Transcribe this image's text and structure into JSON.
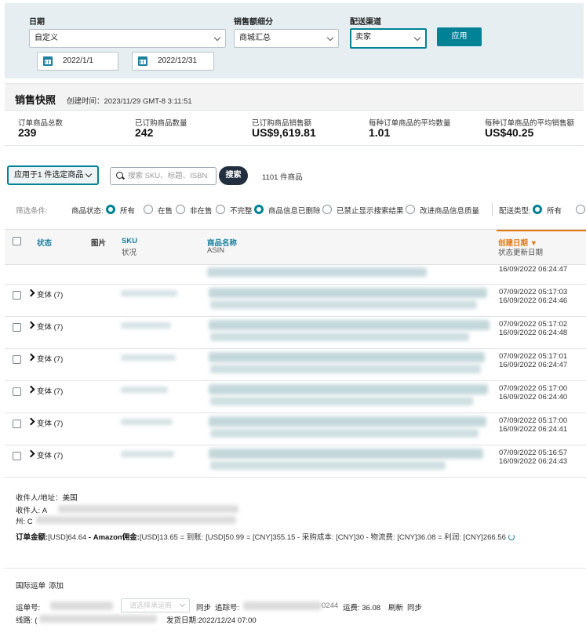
{
  "filters": {
    "date_label": "日期",
    "date_value": "自定义",
    "start_date": "2022/1/1",
    "end_date": "2022/12/31",
    "breakdown_label": "销售额细分",
    "breakdown_value": "商城汇总",
    "channel_label": "配送渠道",
    "channel_value": "卖家",
    "apply_label": "应用"
  },
  "snapshot": {
    "title": "销售快照",
    "created": "创建时间：2023/11/29 GMT-8 3:11:51",
    "metrics": [
      {
        "label": "订单商品总数",
        "value": "239"
      },
      {
        "label": "已订购商品数量",
        "value": "242"
      },
      {
        "label": "已订购商品销售额",
        "value": "US$9,619.81"
      },
      {
        "label": "每种订单商品的平均数量",
        "value": "1.01"
      },
      {
        "label": "每种订单商品的平均销售额",
        "value": "US$40.25"
      }
    ]
  },
  "toolbar": {
    "apply_to": "应用于1 件选定商品",
    "search_placeholder": "搜索 SKU、标题、ISBN",
    "search_button": "搜索",
    "count": "1101 件商品"
  },
  "conditions": {
    "label": "筛选条件:",
    "status_label": "商品状态:",
    "options": [
      "所有",
      "在售",
      "非在售",
      "不完整",
      "商品信息已删除",
      "已禁止显示搜索结果",
      "改进商品信息质量"
    ],
    "delivery_label": "配送类型:",
    "delivery_option": "所有"
  },
  "table": {
    "headers": {
      "status": "状态",
      "image": "图片",
      "sku": "SKU",
      "sku_sub": "状况",
      "name": "商品名称",
      "name_sub": "ASIN",
      "created": "创建日期 ▼",
      "created_sub": "状态更新日期"
    },
    "partial_date": "16/09/2022 06:24:47",
    "rows": [
      {
        "variant": "变体 (7)",
        "created": "07/09/2022 05:17:03",
        "updated": "16/09/2022 06:24:46"
      },
      {
        "variant": "变体 (7)",
        "created": "07/09/2022 05:17:02",
        "updated": "16/09/2022 06:24:48"
      },
      {
        "variant": "变体 (7)",
        "created": "07/09/2022 05:17:01",
        "updated": "16/09/2022 06:24:47"
      },
      {
        "variant": "变体 (7)",
        "created": "07/09/2022 05:17:00",
        "updated": "16/09/2022 06:24:40"
      },
      {
        "variant": "变体 (7)",
        "created": "07/09/2022 05:17:00",
        "updated": "16/09/2022 06:24:41"
      },
      {
        "variant": "变体 (7)",
        "created": "07/09/2022 05:16:57",
        "updated": "16/09/2022 06:24:43"
      }
    ]
  },
  "order": {
    "recipient_address": "收件人/地址：美国",
    "recipient": "收件人: A",
    "state": "州: C",
    "amount_line_1": "订单金额:",
    "amount_line_2": "[USD]64.64",
    "amount_line_3": " - Amazon佣金:",
    "amount_line_4": "[USD]13.65",
    "amount_line_5": " = 到账: [USD]50.99 = [CNY]355.15 - 采购成本: [CNY]30 - 物流费: [CNY]36.08 = 利润: [CNY]266.56"
  },
  "shipping": {
    "title": "国际运单",
    "add_link": "添加",
    "waybill_label": "运单号: ",
    "carrier_placeholder": "请选择承运商",
    "sync_link": "同步",
    "tracking_label": "追踪号:",
    "tracking_tail": "0244",
    "freight": "运费: 36.08",
    "refresh_link": "刷新",
    "sync_link_2": "同步",
    "route_label": "线路: (",
    "ship_date": "发货日期:2022/12/24 07:00"
  }
}
